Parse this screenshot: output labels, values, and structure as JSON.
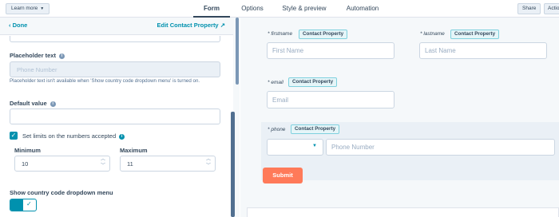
{
  "topbar": {
    "learn_more": "Learn more",
    "tabs": [
      "Form",
      "Options",
      "Style & preview",
      "Automation"
    ],
    "active_tab": "Form",
    "share": "Share",
    "actions": "Actions"
  },
  "editor": {
    "done": "Done",
    "edit_property": "Edit Contact Property",
    "placeholder_label": "Placeholder text",
    "placeholder_value": "Phone Number",
    "placeholder_help": "Placeholder text isn't available when 'Show country code dropdown menu' is turned on.",
    "default_label": "Default value",
    "default_value": "",
    "limits_label": "Set limits on the numbers accepted",
    "limits_checked": true,
    "min_label": "Minimum",
    "min_value": "10",
    "max_label": "Maximum",
    "max_value": "11",
    "country_label": "Show country code dropdown menu",
    "country_enabled": true
  },
  "preview": {
    "badge": "Contact Property",
    "firstname_label": "firstname",
    "firstname_placeholder": "First Name",
    "lastname_label": "lastname",
    "lastname_placeholder": "Last Name",
    "email_label": "email",
    "email_placeholder": "Email",
    "phone_label": "phone",
    "phone_placeholder": "Phone Number",
    "submit": "Submit",
    "required_mark": "*"
  },
  "colors": {
    "accent": "#0091ae",
    "submit": "#ff7a59",
    "text": "#33475b"
  }
}
